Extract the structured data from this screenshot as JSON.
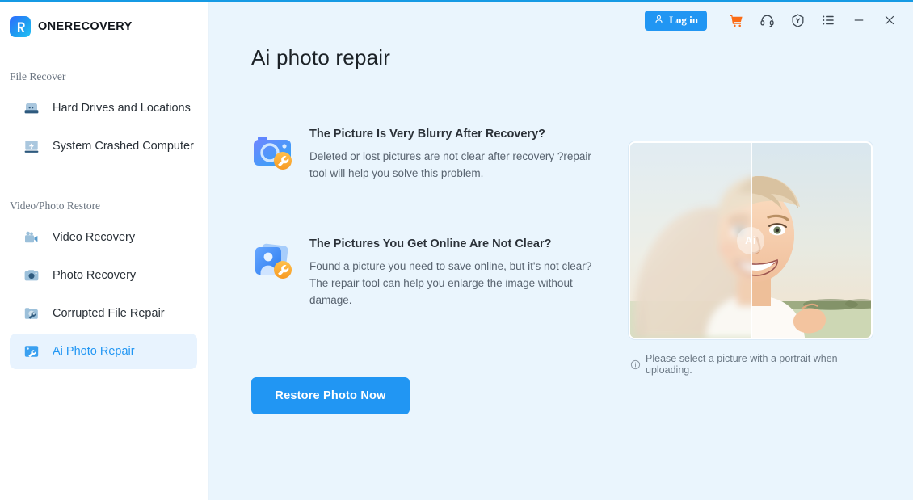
{
  "brand": {
    "name": "ONERECOVERY",
    "logo_icon": "onerecovery-logo-icon"
  },
  "sidebar": {
    "groups": [
      {
        "title": "File Recover",
        "items": [
          {
            "label": "Hard Drives and Locations",
            "icon": "hard-drive-icon",
            "active": false
          },
          {
            "label": "System Crashed Computer",
            "icon": "crashed-computer-icon",
            "active": false
          }
        ]
      },
      {
        "title": "Video/Photo Restore",
        "items": [
          {
            "label": "Video Recovery",
            "icon": "video-camera-icon",
            "active": false
          },
          {
            "label": "Photo Recovery",
            "icon": "camera-icon",
            "active": false
          },
          {
            "label": "Corrupted File Repair",
            "icon": "folder-wrench-icon",
            "active": false
          },
          {
            "label": "Ai Photo Repair",
            "icon": "ai-photo-repair-icon",
            "active": true
          }
        ]
      }
    ]
  },
  "toolbar": {
    "login_label": "Log in",
    "icons": [
      {
        "name": "cart-icon",
        "color": "#fb6c16"
      },
      {
        "name": "headset-icon",
        "color": "#3c4650"
      },
      {
        "name": "shield-award-icon",
        "color": "#3c4650"
      },
      {
        "name": "menu-list-icon",
        "color": "#3c4650"
      },
      {
        "name": "minimize-icon",
        "color": "#3c4650"
      },
      {
        "name": "close-icon",
        "color": "#3c4650"
      }
    ]
  },
  "main": {
    "page_title": "Ai photo repair",
    "features": [
      {
        "icon": "camera-repair-icon",
        "title": "The Picture Is Very Blurry After Recovery?",
        "desc": "Deleted or lost pictures are not clear after recovery ?repair tool will help you solve this problem."
      },
      {
        "icon": "photo-card-repair-icon",
        "title": "The Pictures You Get Online Are Not Clear?",
        "desc": "Found a picture you need to save online, but it's not clear? The repair tool can help you enlarge the image without damage."
      }
    ],
    "cta_label": "Restore Photo Now",
    "preview": {
      "badge_label": "Ai",
      "note": "Please select a picture with a portrait when uploading.",
      "note_icon": "info-icon",
      "alt": "before-after portrait of smiling blonde woman in a field at sunset"
    }
  },
  "colors": {
    "accent": "#2196f3",
    "top_border": "#159ae4",
    "main_bg": "#eaf5fd",
    "sidebar_bg": "#ffffff",
    "active_bg": "#e8f3fe",
    "cart_orange": "#fb6c16"
  }
}
